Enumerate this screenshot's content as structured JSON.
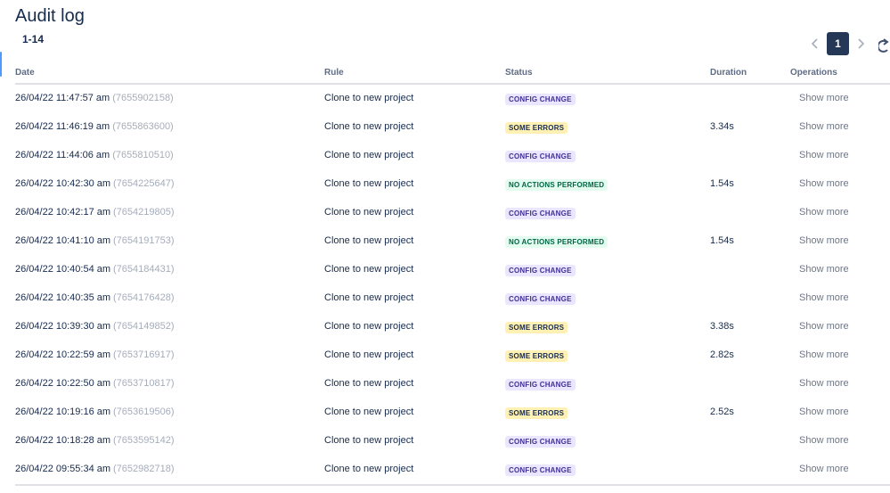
{
  "page": {
    "title": "Audit log",
    "range": "1-14"
  },
  "pagination": {
    "prev_icon": "chevron-left-icon",
    "next_icon": "chevron-right-icon",
    "current_page": "1"
  },
  "columns": {
    "date": "Date",
    "rule": "Rule",
    "status": "Status",
    "duration": "Duration",
    "operations": "Operations"
  },
  "status_colors": {
    "CONFIG CHANGE": "#eae6ff",
    "SOME ERRORS": "#fff0b3",
    "NO ACTIONS PERFORMED": "#e3fcef"
  },
  "rows": [
    {
      "date": "26/04/22 11:47:57 am",
      "id": "(7655902158)",
      "rule": "Clone to new project",
      "status": "CONFIG CHANGE",
      "duration": "",
      "ops": "Show more"
    },
    {
      "date": "26/04/22 11:46:19 am",
      "id": "(7655863600)",
      "rule": "Clone to new project",
      "status": "SOME ERRORS",
      "duration": "3.34s",
      "ops": "Show more"
    },
    {
      "date": "26/04/22 11:44:06 am",
      "id": "(7655810510)",
      "rule": "Clone to new project",
      "status": "CONFIG CHANGE",
      "duration": "",
      "ops": "Show more"
    },
    {
      "date": "26/04/22 10:42:30 am",
      "id": "(7654225647)",
      "rule": "Clone to new project",
      "status": "NO ACTIONS PERFORMED",
      "duration": "1.54s",
      "ops": "Show more"
    },
    {
      "date": "26/04/22 10:42:17 am",
      "id": "(7654219805)",
      "rule": "Clone to new project",
      "status": "CONFIG CHANGE",
      "duration": "",
      "ops": "Show more"
    },
    {
      "date": "26/04/22 10:41:10 am",
      "id": "(7654191753)",
      "rule": "Clone to new project",
      "status": "NO ACTIONS PERFORMED",
      "duration": "1.54s",
      "ops": "Show more"
    },
    {
      "date": "26/04/22 10:40:54 am",
      "id": "(7654184431)",
      "rule": "Clone to new project",
      "status": "CONFIG CHANGE",
      "duration": "",
      "ops": "Show more"
    },
    {
      "date": "26/04/22 10:40:35 am",
      "id": "(7654176428)",
      "rule": "Clone to new project",
      "status": "CONFIG CHANGE",
      "duration": "",
      "ops": "Show more"
    },
    {
      "date": "26/04/22 10:39:30 am",
      "id": "(7654149852)",
      "rule": "Clone to new project",
      "status": "SOME ERRORS",
      "duration": "3.38s",
      "ops": "Show more"
    },
    {
      "date": "26/04/22 10:22:59 am",
      "id": "(7653716917)",
      "rule": "Clone to new project",
      "status": "SOME ERRORS",
      "duration": "2.82s",
      "ops": "Show more"
    },
    {
      "date": "26/04/22 10:22:50 am",
      "id": "(7653710817)",
      "rule": "Clone to new project",
      "status": "CONFIG CHANGE",
      "duration": "",
      "ops": "Show more"
    },
    {
      "date": "26/04/22 10:19:16 am",
      "id": "(7653619506)",
      "rule": "Clone to new project",
      "status": "SOME ERRORS",
      "duration": "2.52s",
      "ops": "Show more"
    },
    {
      "date": "26/04/22 10:18:28 am",
      "id": "(7653595142)",
      "rule": "Clone to new project",
      "status": "CONFIG CHANGE",
      "duration": "",
      "ops": "Show more"
    },
    {
      "date": "26/04/22 09:55:34 am",
      "id": "(7652982718)",
      "rule": "Clone to new project",
      "status": "CONFIG CHANGE",
      "duration": "",
      "ops": "Show more"
    }
  ]
}
